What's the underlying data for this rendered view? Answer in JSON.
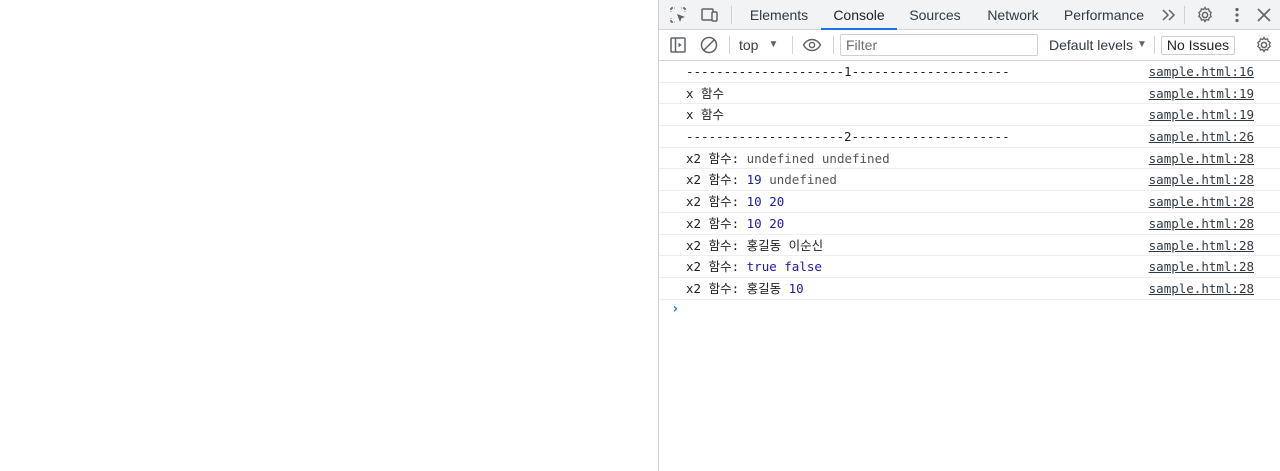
{
  "devtools": {
    "tabs": [
      {
        "label": "Elements"
      },
      {
        "label": "Console",
        "active": true
      },
      {
        "label": "Sources"
      },
      {
        "label": "Network"
      },
      {
        "label": "Performance"
      }
    ],
    "icons": {
      "inspect": "inspect-element-icon",
      "device": "device-toolbar-icon",
      "more_tabs": "chevron-double-right-icon",
      "settings": "gear-icon",
      "menu": "kebab-menu-icon",
      "close": "close-icon"
    },
    "accent_color": "#1a73e8"
  },
  "toolbar": {
    "context": "top",
    "filter_placeholder": "Filter",
    "levels": "Default levels",
    "issues": "No Issues",
    "icons": {
      "sidebar": "sidebar-toggle-icon",
      "clear": "clear-console-icon",
      "live_expression": "eye-icon",
      "settings": "gear-icon"
    }
  },
  "console": {
    "messages": [
      {
        "parts": [
          {
            "t": "---------------------1---------------------",
            "k": "plain"
          }
        ],
        "source": "sample.html:16"
      },
      {
        "parts": [
          {
            "t": "x 함수",
            "k": "plain"
          }
        ],
        "source": "sample.html:19"
      },
      {
        "parts": [
          {
            "t": "x 함수",
            "k": "plain"
          }
        ],
        "source": "sample.html:19"
      },
      {
        "parts": [
          {
            "t": "---------------------2---------------------",
            "k": "plain"
          }
        ],
        "source": "sample.html:26"
      },
      {
        "parts": [
          {
            "t": "x2 함수: ",
            "k": "plain"
          },
          {
            "t": "undefined undefined",
            "k": "undef"
          }
        ],
        "source": "sample.html:28"
      },
      {
        "parts": [
          {
            "t": "x2 함수: ",
            "k": "plain"
          },
          {
            "t": "19",
            "k": "num"
          },
          {
            "t": " undefined",
            "k": "undef"
          }
        ],
        "source": "sample.html:28"
      },
      {
        "parts": [
          {
            "t": "x2 함수: ",
            "k": "plain"
          },
          {
            "t": "10 20",
            "k": "num"
          }
        ],
        "source": "sample.html:28"
      },
      {
        "parts": [
          {
            "t": "x2 함수: ",
            "k": "plain"
          },
          {
            "t": "10 20",
            "k": "num"
          }
        ],
        "source": "sample.html:28"
      },
      {
        "parts": [
          {
            "t": "x2 함수: 홍길동 이순신",
            "k": "plain"
          }
        ],
        "source": "sample.html:28"
      },
      {
        "parts": [
          {
            "t": "x2 함수: ",
            "k": "plain"
          },
          {
            "t": "true false",
            "k": "num"
          }
        ],
        "source": "sample.html:28"
      },
      {
        "parts": [
          {
            "t": "x2 함수: 홍길동 ",
            "k": "plain"
          },
          {
            "t": "10",
            "k": "num"
          }
        ],
        "source": "sample.html:28"
      }
    ],
    "prompt": "›"
  }
}
